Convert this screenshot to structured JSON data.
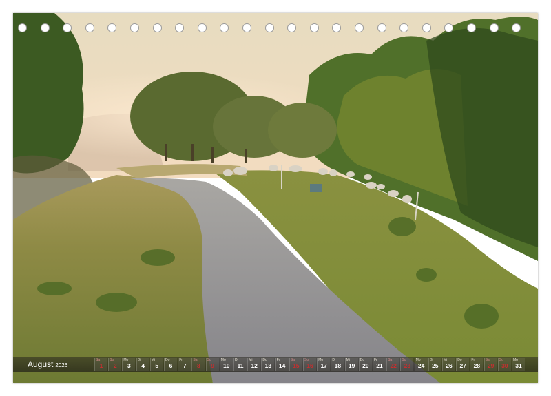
{
  "calendar": {
    "month": "August",
    "year": "2026",
    "days": [
      {
        "wd": "Sa",
        "num": "1",
        "weekend": true
      },
      {
        "wd": "So",
        "num": "2",
        "weekend": true
      },
      {
        "wd": "Mo",
        "num": "3",
        "weekend": false
      },
      {
        "wd": "Di",
        "num": "4",
        "weekend": false
      },
      {
        "wd": "Mi",
        "num": "5",
        "weekend": false
      },
      {
        "wd": "Do",
        "num": "6",
        "weekend": false
      },
      {
        "wd": "Fr",
        "num": "7",
        "weekend": false
      },
      {
        "wd": "Sa",
        "num": "8",
        "weekend": true
      },
      {
        "wd": "So",
        "num": "9",
        "weekend": true
      },
      {
        "wd": "Mo",
        "num": "10",
        "weekend": false
      },
      {
        "wd": "Di",
        "num": "11",
        "weekend": false
      },
      {
        "wd": "Mi",
        "num": "12",
        "weekend": false
      },
      {
        "wd": "Do",
        "num": "13",
        "weekend": false
      },
      {
        "wd": "Fr",
        "num": "14",
        "weekend": false
      },
      {
        "wd": "Sa",
        "num": "15",
        "weekend": true
      },
      {
        "wd": "So",
        "num": "16",
        "weekend": true
      },
      {
        "wd": "Mo",
        "num": "17",
        "weekend": false
      },
      {
        "wd": "Di",
        "num": "18",
        "weekend": false
      },
      {
        "wd": "Mi",
        "num": "19",
        "weekend": false
      },
      {
        "wd": "Do",
        "num": "20",
        "weekend": false
      },
      {
        "wd": "Fr",
        "num": "21",
        "weekend": false
      },
      {
        "wd": "Sa",
        "num": "22",
        "weekend": true
      },
      {
        "wd": "So",
        "num": "23",
        "weekend": true
      },
      {
        "wd": "Mo",
        "num": "24",
        "weekend": false
      },
      {
        "wd": "Di",
        "num": "25",
        "weekend": false
      },
      {
        "wd": "Mi",
        "num": "26",
        "weekend": false
      },
      {
        "wd": "Do",
        "num": "27",
        "weekend": false
      },
      {
        "wd": "Fr",
        "num": "28",
        "weekend": false
      },
      {
        "wd": "Sa",
        "num": "29",
        "weekend": true
      },
      {
        "wd": "So",
        "num": "30",
        "weekend": true
      },
      {
        "wd": "Mo",
        "num": "31",
        "weekend": false
      }
    ]
  },
  "photo": {
    "sky_color": "#e8d9b8",
    "grass_color": "#7f8a3c",
    "path_color": "#8f8f95",
    "tree_color": "#3f5a24"
  },
  "binding_hole_count": 23
}
